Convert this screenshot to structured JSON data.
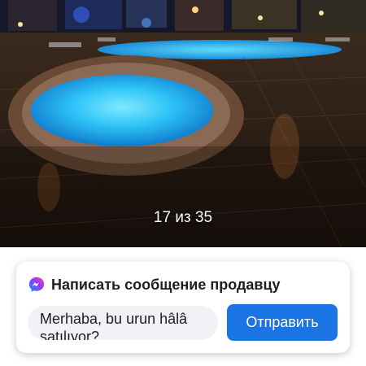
{
  "gallery": {
    "counter": "17 из 35"
  },
  "contact": {
    "icon": "messenger-icon",
    "title": "Написать сообщение продавцу",
    "message": "Merhaba, bu urun hâlâ satılıyor?",
    "send_label": "Отправить"
  },
  "colors": {
    "accent": "#1b74e4",
    "input_bg": "#f0f2f5"
  }
}
